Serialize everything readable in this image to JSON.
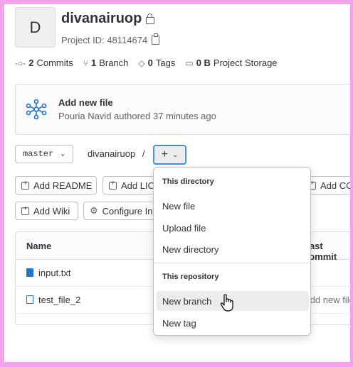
{
  "project": {
    "avatar_letter": "D",
    "name": "divanairuop",
    "id_label": "Project ID: 48114674"
  },
  "stats": [
    {
      "icon": "commit-icon",
      "count": "2",
      "label": "Commits"
    },
    {
      "icon": "branch-icon",
      "count": "1",
      "label": "Branch"
    },
    {
      "icon": "tag-icon",
      "count": "0",
      "label": "Tags"
    },
    {
      "icon": "storage-icon",
      "count": "0 B",
      "label": "Project Storage"
    }
  ],
  "last_commit": {
    "title": "Add new file",
    "author": "Pouria Navid",
    "meta": "Pouria Navid authored 37 minutes ago"
  },
  "repo_nav": {
    "branch": "master",
    "breadcrumb": "divanairuop",
    "separator": "/"
  },
  "quick_actions": [
    {
      "label": "Add README"
    },
    {
      "label": "Add LICENSE"
    },
    {
      "label": "Add CONTRIBUTING"
    },
    {
      "label": "Add Wiki"
    },
    {
      "label": "Configure Integrations"
    }
  ],
  "file_table": {
    "headers": {
      "name": "Name",
      "last_commit": "Last commit"
    },
    "rows": [
      {
        "name": "input.txt",
        "commit": ""
      },
      {
        "name": "test_file_2",
        "commit": "Add new file"
      }
    ]
  },
  "dropdown": {
    "section_1": "This directory",
    "items_1": [
      "New file",
      "Upload file",
      "New directory"
    ],
    "section_2": "This repository",
    "items_2": [
      "New branch",
      "New tag"
    ],
    "hovered": "New branch"
  },
  "colors": {
    "accent": "#428fdc",
    "file_icon": "#1f75cb",
    "frame_border": "#f3a2ec"
  }
}
